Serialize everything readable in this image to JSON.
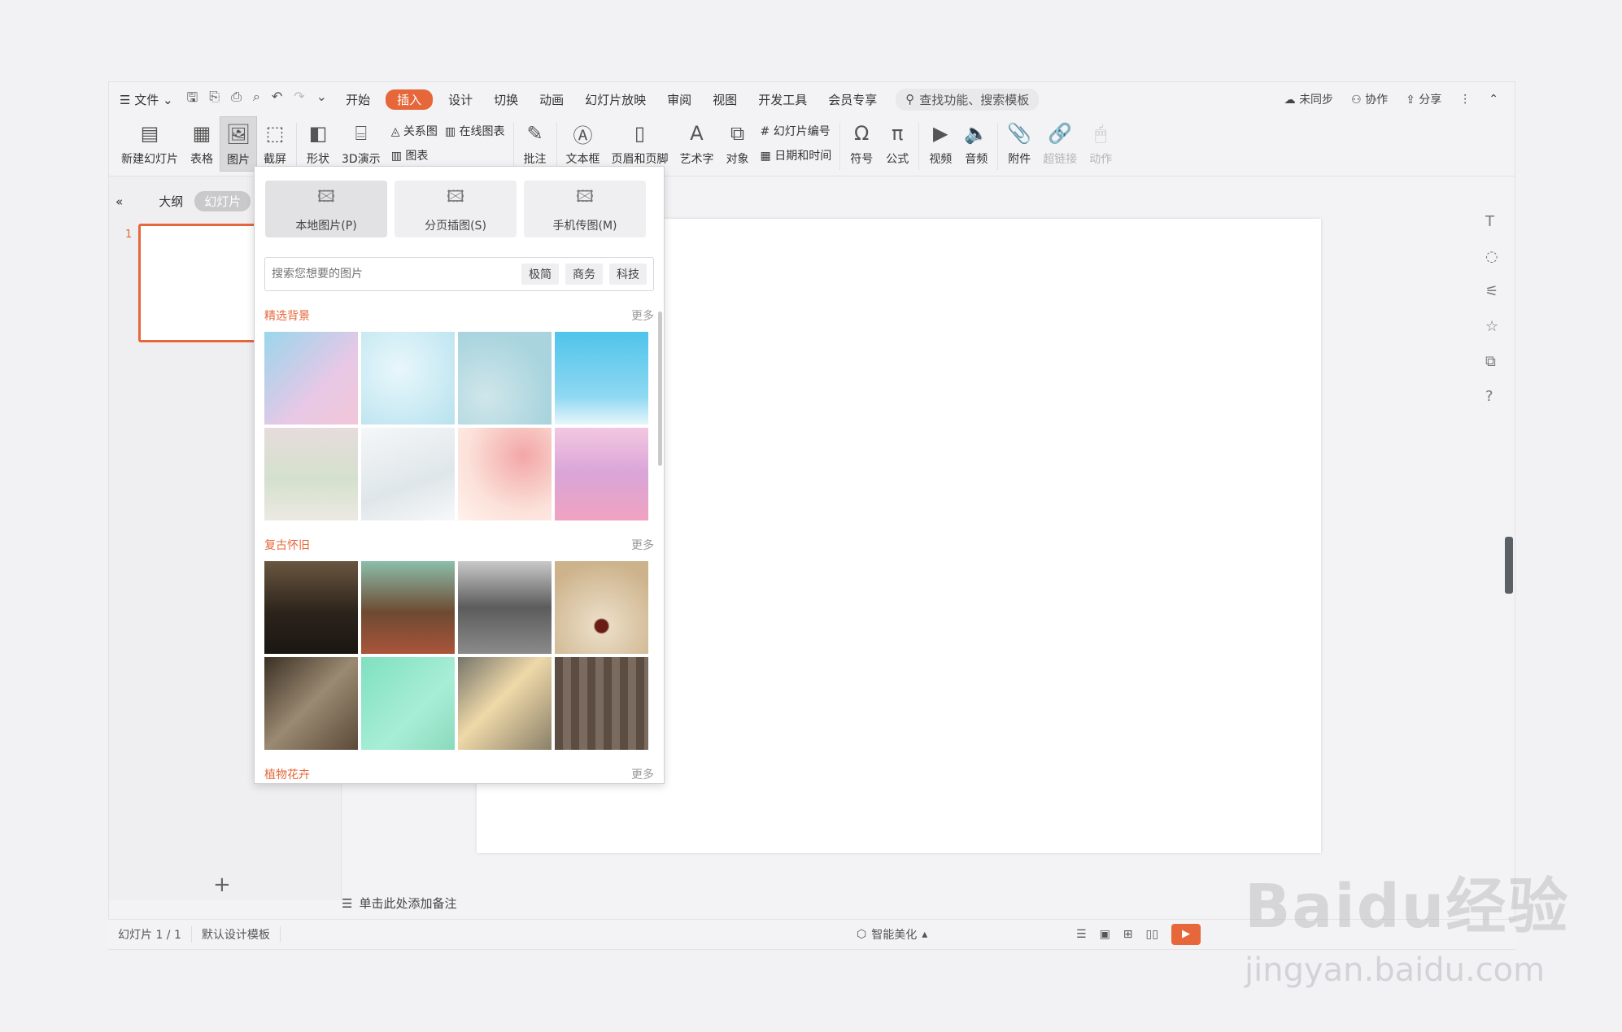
{
  "menubar": {
    "file_label": "文件",
    "tabs": [
      "开始",
      "插入",
      "设计",
      "切换",
      "动画",
      "幻灯片放映",
      "审阅",
      "视图",
      "开发工具",
      "会员专享"
    ],
    "active_tab": "插入",
    "search_placeholder": "查找功能、搜索模板",
    "sync_label": "未同步",
    "collab_label": "协作",
    "share_label": "分享"
  },
  "ribbon": {
    "new_slide": "新建幻灯片",
    "table": "表格",
    "picture": "图片",
    "screenshot": "截屏",
    "shape": "形状",
    "demo3d": "3D演示",
    "relation": "关系图",
    "online_chart": "在线图表",
    "chart": "图表",
    "comment": "批注",
    "textbox": "文本框",
    "header_footer": "页眉和页脚",
    "wordart": "艺术字",
    "object": "对象",
    "slide_number": "幻灯片编号",
    "datetime": "日期和时间",
    "symbol": "符号",
    "formula": "公式",
    "video": "视频",
    "audio": "音频",
    "attachment": "附件",
    "hyperlink": "超链接",
    "action": "动作"
  },
  "leftpanel": {
    "outline_tab": "大纲",
    "slides_tab": "幻灯片",
    "slide_number": "1"
  },
  "picture_menu": {
    "tabs": [
      "本地图片(P)",
      "分页插图(S)",
      "手机传图(M)"
    ],
    "search_placeholder": "搜索您想要的图片",
    "tags": [
      "极简",
      "商务",
      "科技"
    ],
    "sections": [
      {
        "title": "精选背景",
        "more": "更多"
      },
      {
        "title": "复古怀旧",
        "more": "更多"
      },
      {
        "title": "植物花卉",
        "more": "更多"
      }
    ]
  },
  "notes_label": "单击此处添加备注",
  "statusbar": {
    "slide_info": "幻灯片 1 / 1",
    "template": "默认设计模板",
    "beautify": "智能美化"
  },
  "watermark": {
    "main": "Baidu经验",
    "sub": "jingyan.baidu.com"
  },
  "colors": {
    "accent": "#e5673a",
    "background": "#f2f2f4"
  }
}
